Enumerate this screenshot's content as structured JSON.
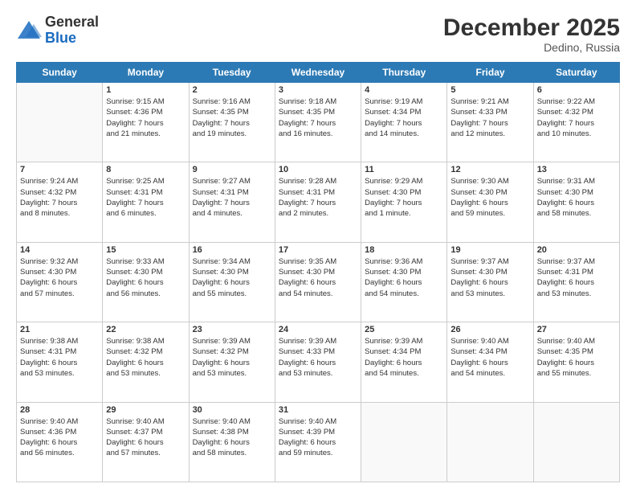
{
  "logo": {
    "general": "General",
    "blue": "Blue"
  },
  "title": "December 2025",
  "location": "Dedino, Russia",
  "days_of_week": [
    "Sunday",
    "Monday",
    "Tuesday",
    "Wednesday",
    "Thursday",
    "Friday",
    "Saturday"
  ],
  "weeks": [
    [
      {
        "day": "",
        "details": ""
      },
      {
        "day": "1",
        "details": "Sunrise: 9:15 AM\nSunset: 4:36 PM\nDaylight: 7 hours\nand 21 minutes."
      },
      {
        "day": "2",
        "details": "Sunrise: 9:16 AM\nSunset: 4:35 PM\nDaylight: 7 hours\nand 19 minutes."
      },
      {
        "day": "3",
        "details": "Sunrise: 9:18 AM\nSunset: 4:35 PM\nDaylight: 7 hours\nand 16 minutes."
      },
      {
        "day": "4",
        "details": "Sunrise: 9:19 AM\nSunset: 4:34 PM\nDaylight: 7 hours\nand 14 minutes."
      },
      {
        "day": "5",
        "details": "Sunrise: 9:21 AM\nSunset: 4:33 PM\nDaylight: 7 hours\nand 12 minutes."
      },
      {
        "day": "6",
        "details": "Sunrise: 9:22 AM\nSunset: 4:32 PM\nDaylight: 7 hours\nand 10 minutes."
      }
    ],
    [
      {
        "day": "7",
        "details": "Sunrise: 9:24 AM\nSunset: 4:32 PM\nDaylight: 7 hours\nand 8 minutes."
      },
      {
        "day": "8",
        "details": "Sunrise: 9:25 AM\nSunset: 4:31 PM\nDaylight: 7 hours\nand 6 minutes."
      },
      {
        "day": "9",
        "details": "Sunrise: 9:27 AM\nSunset: 4:31 PM\nDaylight: 7 hours\nand 4 minutes."
      },
      {
        "day": "10",
        "details": "Sunrise: 9:28 AM\nSunset: 4:31 PM\nDaylight: 7 hours\nand 2 minutes."
      },
      {
        "day": "11",
        "details": "Sunrise: 9:29 AM\nSunset: 4:30 PM\nDaylight: 7 hours\nand 1 minute."
      },
      {
        "day": "12",
        "details": "Sunrise: 9:30 AM\nSunset: 4:30 PM\nDaylight: 6 hours\nand 59 minutes."
      },
      {
        "day": "13",
        "details": "Sunrise: 9:31 AM\nSunset: 4:30 PM\nDaylight: 6 hours\nand 58 minutes."
      }
    ],
    [
      {
        "day": "14",
        "details": "Sunrise: 9:32 AM\nSunset: 4:30 PM\nDaylight: 6 hours\nand 57 minutes."
      },
      {
        "day": "15",
        "details": "Sunrise: 9:33 AM\nSunset: 4:30 PM\nDaylight: 6 hours\nand 56 minutes."
      },
      {
        "day": "16",
        "details": "Sunrise: 9:34 AM\nSunset: 4:30 PM\nDaylight: 6 hours\nand 55 minutes."
      },
      {
        "day": "17",
        "details": "Sunrise: 9:35 AM\nSunset: 4:30 PM\nDaylight: 6 hours\nand 54 minutes."
      },
      {
        "day": "18",
        "details": "Sunrise: 9:36 AM\nSunset: 4:30 PM\nDaylight: 6 hours\nand 54 minutes."
      },
      {
        "day": "19",
        "details": "Sunrise: 9:37 AM\nSunset: 4:30 PM\nDaylight: 6 hours\nand 53 minutes."
      },
      {
        "day": "20",
        "details": "Sunrise: 9:37 AM\nSunset: 4:31 PM\nDaylight: 6 hours\nand 53 minutes."
      }
    ],
    [
      {
        "day": "21",
        "details": "Sunrise: 9:38 AM\nSunset: 4:31 PM\nDaylight: 6 hours\nand 53 minutes."
      },
      {
        "day": "22",
        "details": "Sunrise: 9:38 AM\nSunset: 4:32 PM\nDaylight: 6 hours\nand 53 minutes."
      },
      {
        "day": "23",
        "details": "Sunrise: 9:39 AM\nSunset: 4:32 PM\nDaylight: 6 hours\nand 53 minutes."
      },
      {
        "day": "24",
        "details": "Sunrise: 9:39 AM\nSunset: 4:33 PM\nDaylight: 6 hours\nand 53 minutes."
      },
      {
        "day": "25",
        "details": "Sunrise: 9:39 AM\nSunset: 4:34 PM\nDaylight: 6 hours\nand 54 minutes."
      },
      {
        "day": "26",
        "details": "Sunrise: 9:40 AM\nSunset: 4:34 PM\nDaylight: 6 hours\nand 54 minutes."
      },
      {
        "day": "27",
        "details": "Sunrise: 9:40 AM\nSunset: 4:35 PM\nDaylight: 6 hours\nand 55 minutes."
      }
    ],
    [
      {
        "day": "28",
        "details": "Sunrise: 9:40 AM\nSunset: 4:36 PM\nDaylight: 6 hours\nand 56 minutes."
      },
      {
        "day": "29",
        "details": "Sunrise: 9:40 AM\nSunset: 4:37 PM\nDaylight: 6 hours\nand 57 minutes."
      },
      {
        "day": "30",
        "details": "Sunrise: 9:40 AM\nSunset: 4:38 PM\nDaylight: 6 hours\nand 58 minutes."
      },
      {
        "day": "31",
        "details": "Sunrise: 9:40 AM\nSunset: 4:39 PM\nDaylight: 6 hours\nand 59 minutes."
      },
      {
        "day": "",
        "details": ""
      },
      {
        "day": "",
        "details": ""
      },
      {
        "day": "",
        "details": ""
      }
    ]
  ]
}
